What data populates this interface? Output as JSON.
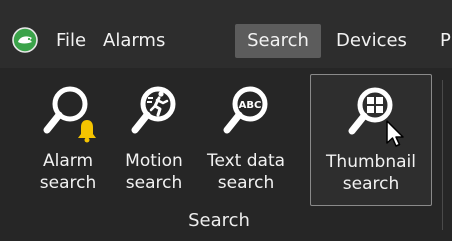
{
  "menubar": {
    "items": [
      {
        "label": "File"
      },
      {
        "label": "Alarms"
      },
      {
        "label": "Search",
        "active": true
      },
      {
        "label": "Devices"
      },
      {
        "label": "P"
      }
    ]
  },
  "ribbon": {
    "group_label": "Search",
    "buttons": [
      {
        "line1": "Alarm",
        "line2": "search",
        "icon": "alarm-search-icon"
      },
      {
        "line1": "Motion",
        "line2": "search",
        "icon": "motion-search-icon"
      },
      {
        "line1": "Text data",
        "line2": "search",
        "icon": "text-search-icon",
        "icon_text": "ABC"
      },
      {
        "line1": "Thumbnail",
        "line2": "search",
        "icon": "thumbnail-search-icon",
        "selected": true
      }
    ]
  },
  "colors": {
    "bell": "#f5c400",
    "active_menu": "#5c5c5c",
    "logo": "#3ba34a"
  }
}
